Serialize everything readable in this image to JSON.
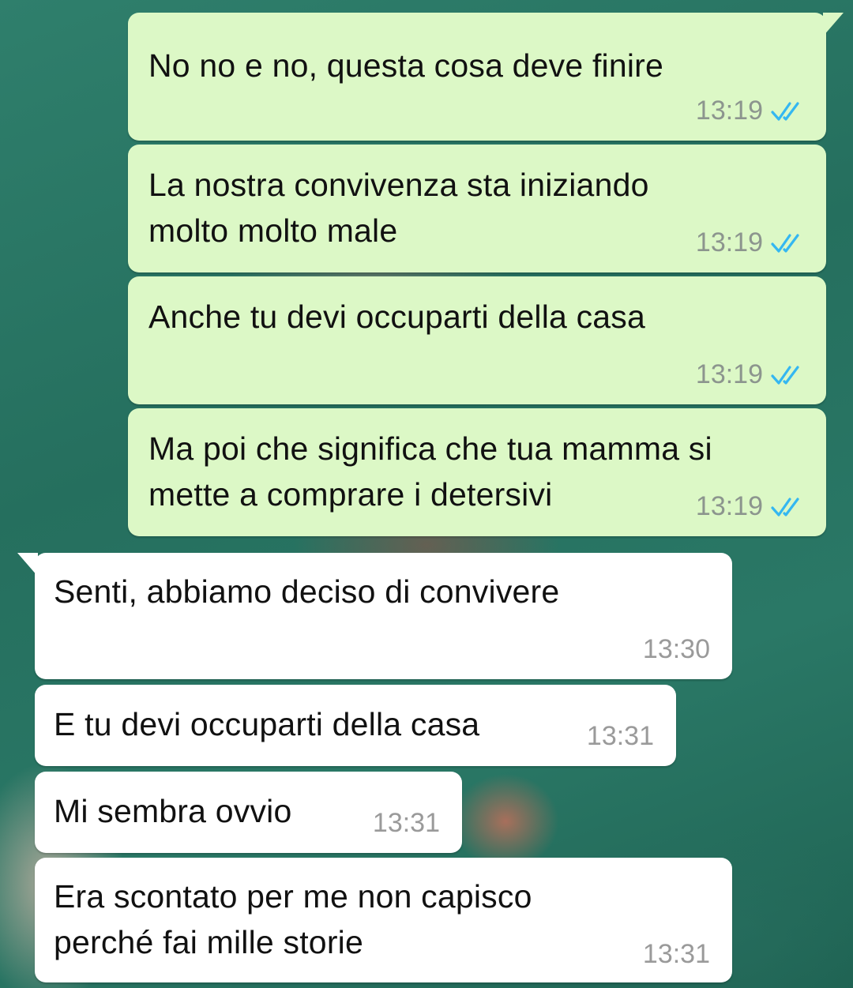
{
  "colors": {
    "outgoing_bubble": "#dcf8c6",
    "incoming_bubble": "#ffffff",
    "read_tick": "#34b7f1",
    "timestamp": "#8c958e",
    "wallpaper": "#2f7f6c"
  },
  "messages": [
    {
      "direction": "outgoing",
      "text": "No no e no, questa cosa deve finire",
      "time": "13:19",
      "status_icon": "double-check-read-icon"
    },
    {
      "direction": "outgoing",
      "text": "La nostra convivenza sta iniziando\nmolto molto male",
      "time": "13:19",
      "status_icon": "double-check-read-icon"
    },
    {
      "direction": "outgoing",
      "text": "Anche tu devi occuparti della casa",
      "time": "13:19",
      "status_icon": "double-check-read-icon"
    },
    {
      "direction": "outgoing",
      "text": "Ma poi che significa che tua mamma si\nmette a comprare i detersivi",
      "time": "13:19",
      "status_icon": "double-check-read-icon"
    },
    {
      "direction": "incoming",
      "text": "Senti, abbiamo deciso di convivere",
      "time": "13:30"
    },
    {
      "direction": "incoming",
      "text": "E tu devi occuparti della casa",
      "time": "13:31"
    },
    {
      "direction": "incoming",
      "text": "Mi sembra ovvio",
      "time": "13:31"
    },
    {
      "direction": "incoming",
      "text": "Era scontato per me non capisco\nperché fai mille storie",
      "time": "13:31"
    }
  ]
}
